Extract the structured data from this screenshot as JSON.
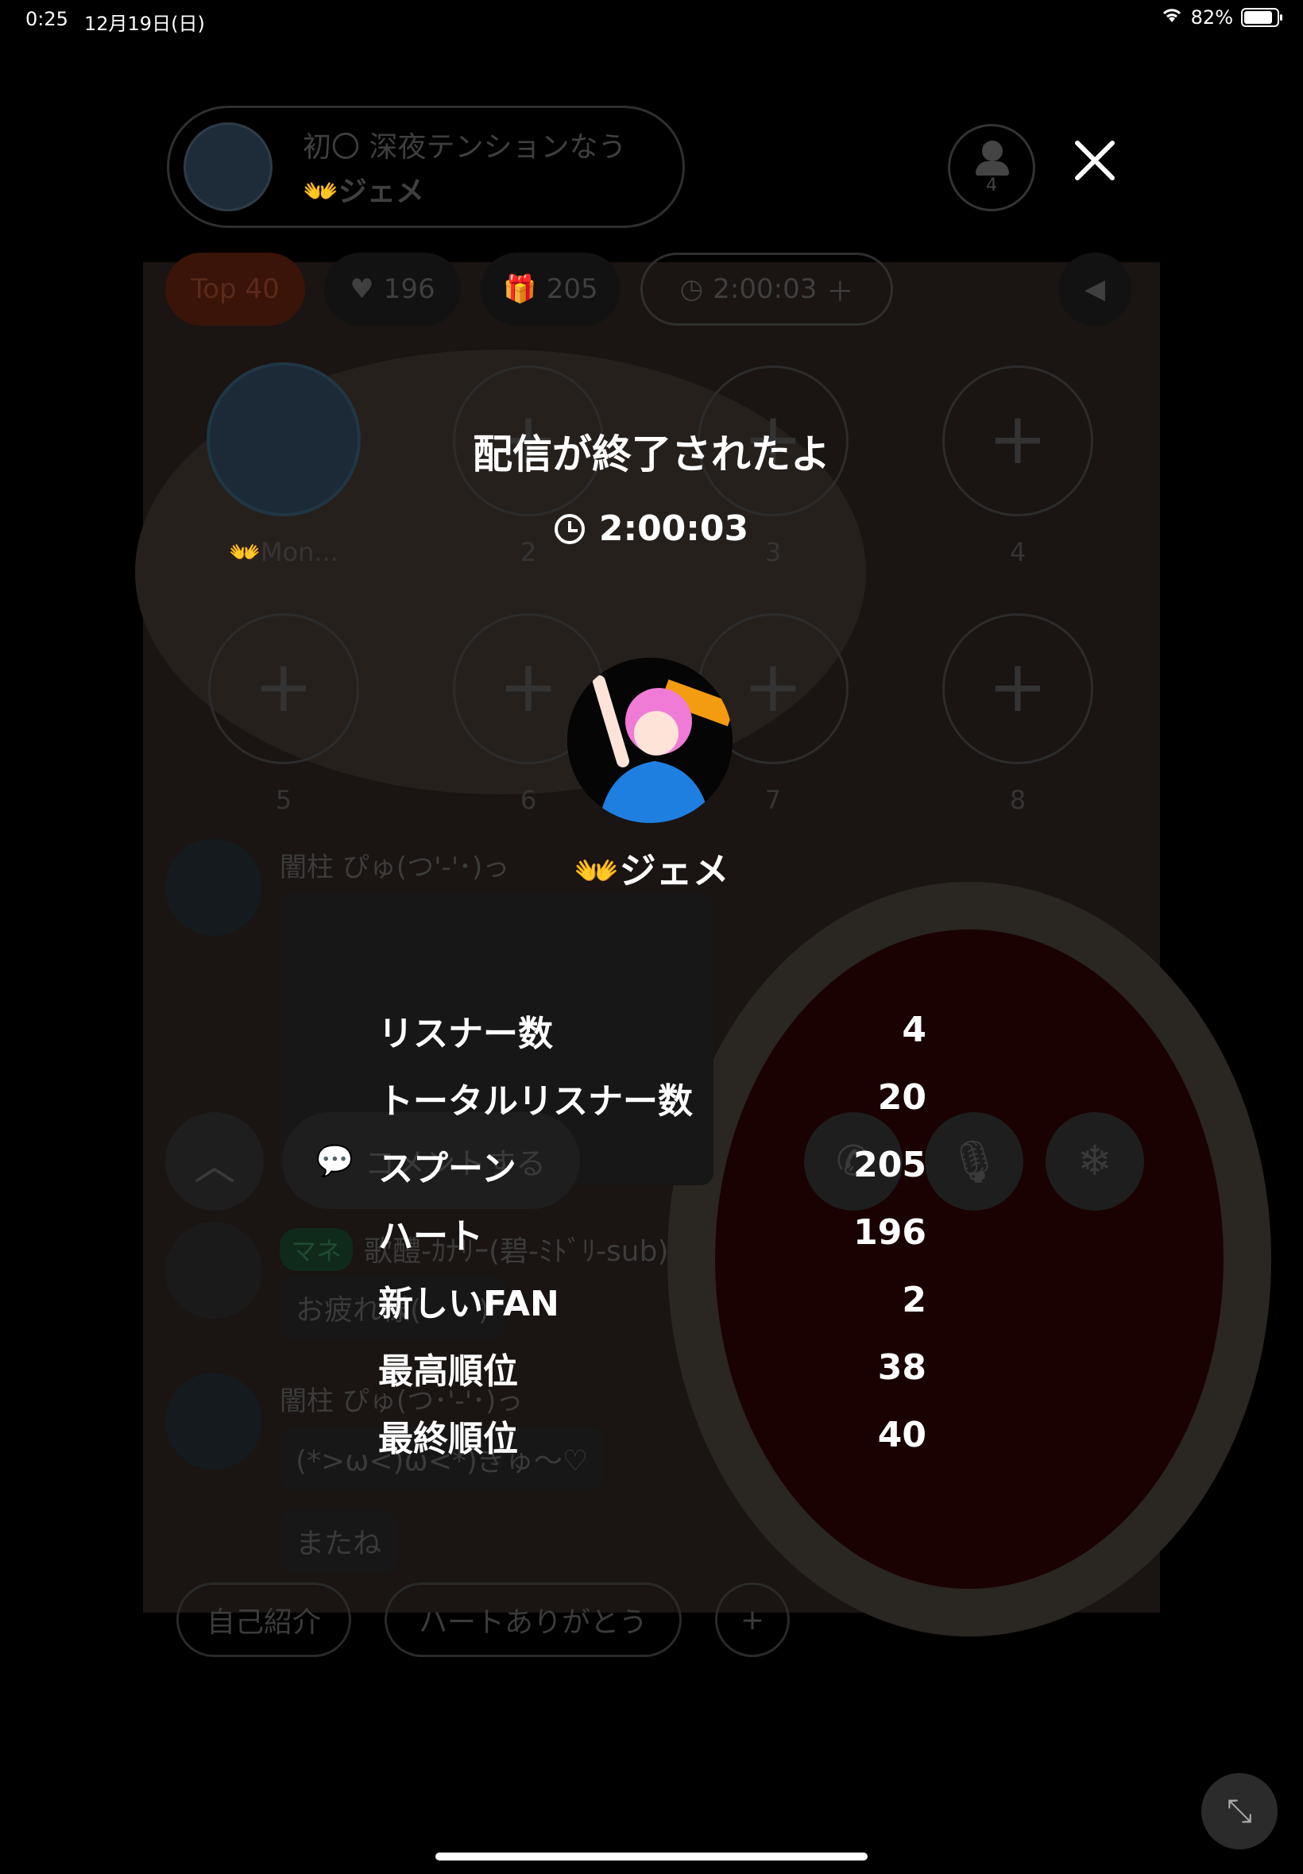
{
  "status_bar": {
    "time": "0:25",
    "date": "12月19日(日)",
    "battery": "82%"
  },
  "header": {
    "title": "初〇 深夜テンションなう",
    "host": "👐ジェメ",
    "listener_count": "4"
  },
  "chips": {
    "top": "Top 40",
    "hearts": "196",
    "spoons": "205",
    "timer": "2:00:03"
  },
  "seats": {
    "host_name": "👐Mon...",
    "numbers": [
      "2",
      "3",
      "4",
      "5",
      "6",
      "7",
      "8"
    ]
  },
  "chat": {
    "user1": "闇柱",
    "user1_suffix": "ぴゅ(つ'-'･)っ",
    "user2_badge": "マネ",
    "user2": "歌醴-ｶﾅﾘｰ(碧-ﾐﾄﾞﾘ-sub)",
    "user2_msg": "お疲れ様(　　)",
    "user3": "闇柱",
    "user3_suffix": "ぴゅ(つ･'-'･)っ",
    "user3_msg": "(*>ω<)ω<*)ぎゅ〜♡",
    "user3_msg2": "またね"
  },
  "quick_replies": [
    "自己紹介",
    "ハートありがとう"
  ],
  "bottom": {
    "comment_label": "コメントする"
  },
  "overlay": {
    "title": "配信が終了されたよ",
    "duration": "2:00:03",
    "host_name": "👐ジェメ",
    "stats": [
      {
        "label": "リスナー数",
        "value": "4"
      },
      {
        "label": "トータルリスナー数",
        "value": "20"
      },
      {
        "label": "スプーン",
        "value": "205"
      },
      {
        "label": "ハート",
        "value": "196"
      },
      {
        "label": "新しいFAN",
        "value": "2"
      },
      {
        "label": "最高順位",
        "value": "38"
      },
      {
        "label": "最終順位",
        "value": "40"
      }
    ]
  }
}
